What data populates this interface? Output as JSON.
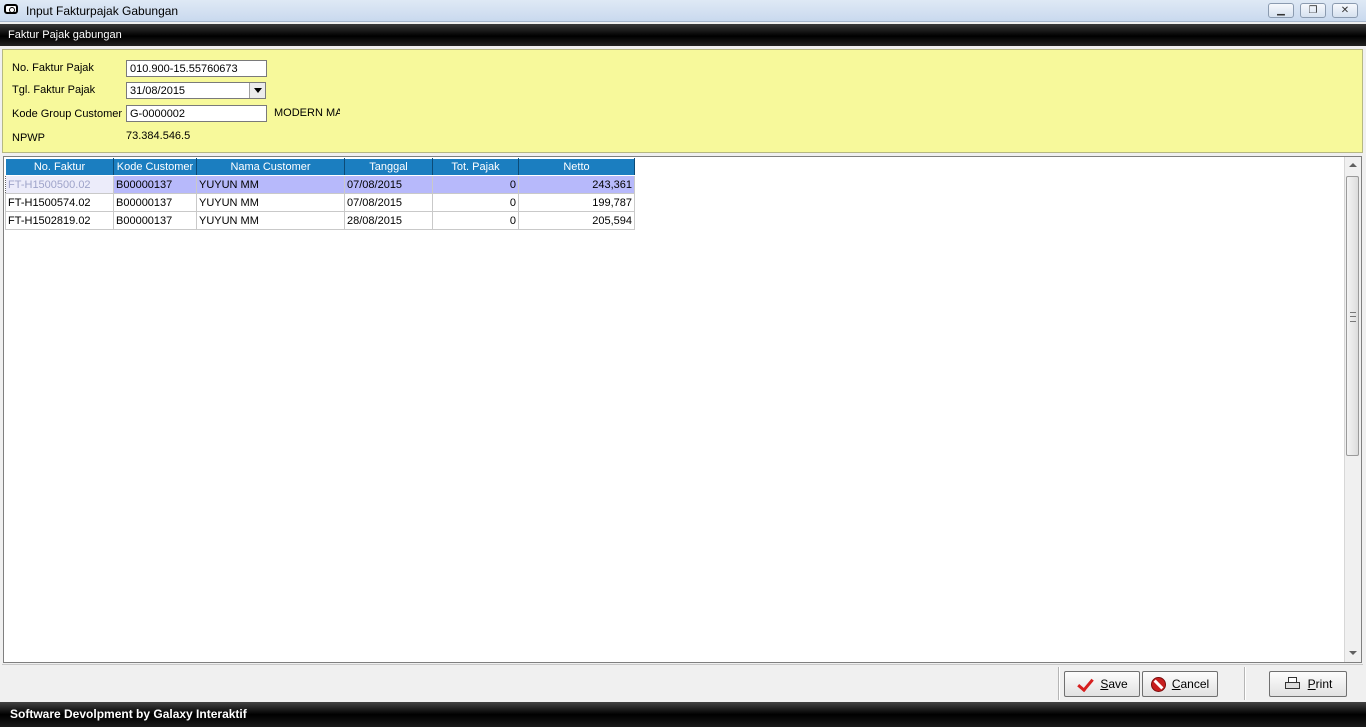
{
  "window": {
    "title": "Input Fakturpajak Gabungan",
    "minimize_glyph": "▁",
    "restore_glyph": "❐",
    "close_glyph": "✕"
  },
  "banner": {
    "text": "Faktur Pajak gabungan"
  },
  "form": {
    "no_faktur_label": "No. Faktur Pajak",
    "no_faktur_value": "010.900-15.55760673",
    "tgl_label": "Tgl. Faktur Pajak",
    "tgl_value": "31/08/2015",
    "group_label": "Kode Group Customer",
    "group_value": "G-0000002",
    "group_name": "MODERN MAR",
    "npwp_label": "NPWP",
    "npwp_value": "73.384.546.5"
  },
  "grid": {
    "columns": [
      "No. Faktur",
      "Kode Customer",
      "Nama Customer",
      "Tanggal",
      "Tot. Pajak",
      "Netto"
    ],
    "rows": [
      [
        "FT-H1500500.02",
        "B00000137",
        "YUYUN MM",
        "07/08/2015",
        "0",
        "243,361"
      ],
      [
        "FT-H1500574.02",
        "B00000137",
        "YUYUN MM",
        "07/08/2015",
        "0",
        "199,787"
      ],
      [
        "FT-H1502819.02",
        "B00000137",
        "YUYUN MM",
        "28/08/2015",
        "0",
        "205,594"
      ]
    ],
    "selected_row": 0
  },
  "buttons": {
    "save": "Save",
    "cancel": "Cancel",
    "print": "Print"
  },
  "status": {
    "text": "Software Devolpment by Galaxy Interaktif"
  },
  "colors": {
    "header_bg": "#f7f99b",
    "grid_header": "#1b7ec0",
    "selected_row": "#b7b9fb"
  }
}
